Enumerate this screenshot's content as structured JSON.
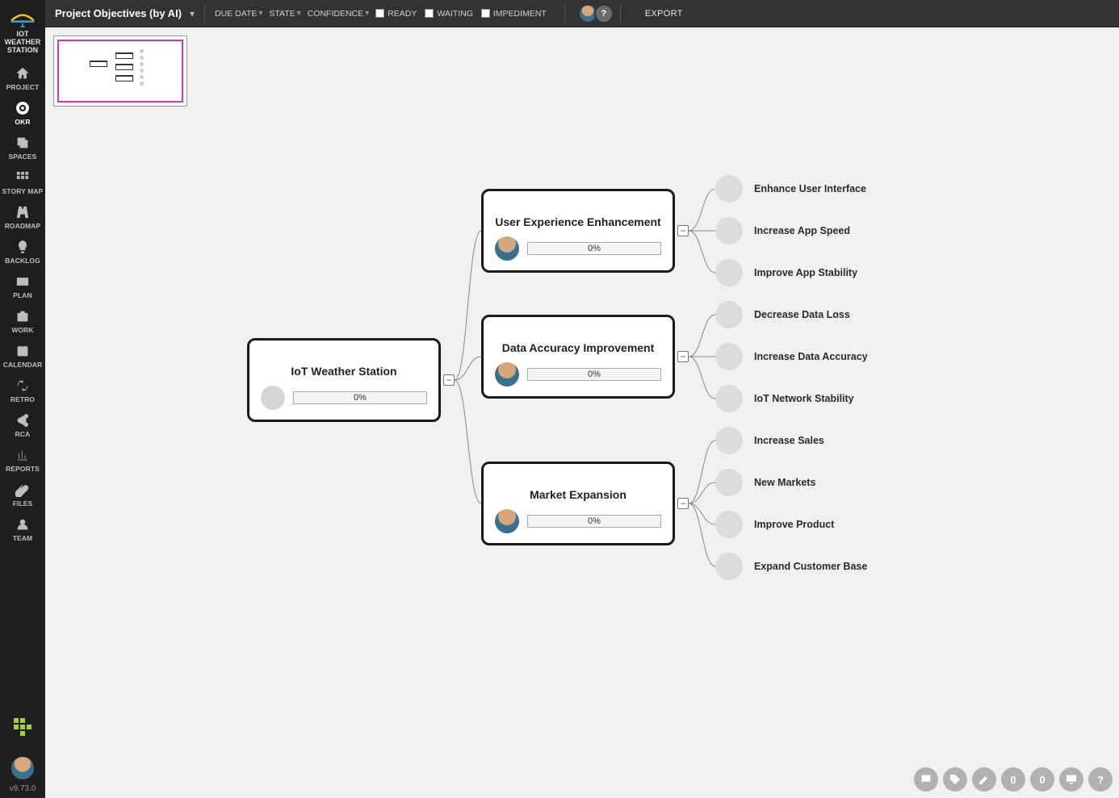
{
  "project_name": "IOT WEATHER STATION",
  "version": "v9.73.0",
  "sidebar": [
    {
      "label": "PROJECT",
      "icon": "home"
    },
    {
      "label": "OKR",
      "icon": "target",
      "active": true
    },
    {
      "label": "SPACES",
      "icon": "copy"
    },
    {
      "label": "STORY MAP",
      "icon": "grid"
    },
    {
      "label": "ROADMAP",
      "icon": "road"
    },
    {
      "label": "BACKLOG",
      "icon": "bulb"
    },
    {
      "label": "PLAN",
      "icon": "card"
    },
    {
      "label": "WORK",
      "icon": "briefcase"
    },
    {
      "label": "CALENDAR",
      "icon": "calendar"
    },
    {
      "label": "RETRO",
      "icon": "loop"
    },
    {
      "label": "RCA",
      "icon": "share"
    },
    {
      "label": "REPORTS",
      "icon": "chart"
    },
    {
      "label": "FILES",
      "icon": "clip"
    },
    {
      "label": "TEAM",
      "icon": "user"
    }
  ],
  "topbar": {
    "title": "Project Objectives (by AI)",
    "filters": [
      {
        "label": "DUE DATE"
      },
      {
        "label": "STATE"
      },
      {
        "label": "CONFIDENCE"
      }
    ],
    "checks": [
      {
        "label": "READY"
      },
      {
        "label": "WAITING"
      },
      {
        "label": "IMPEDIMENT"
      }
    ],
    "export": "EXPORT"
  },
  "tree": {
    "root": {
      "title": "IoT Weather Station",
      "progress": "0%"
    },
    "l2": [
      {
        "title": "User Experience Enhancement",
        "progress": "0%"
      },
      {
        "title": "Data Accuracy Improvement",
        "progress": "0%"
      },
      {
        "title": "Market Expansion",
        "progress": "0%"
      }
    ],
    "l3": [
      [
        "Enhance User Interface",
        "Increase App Speed",
        "Improve App Stability"
      ],
      [
        "Decrease Data Loss",
        "Increase Data Accuracy",
        "IoT Network Stability"
      ],
      [
        "Increase Sales",
        "New Markets",
        "Improve Product",
        "Expand Customer Base"
      ]
    ]
  },
  "dock": {
    "badge1": "0",
    "badge2": "0"
  }
}
